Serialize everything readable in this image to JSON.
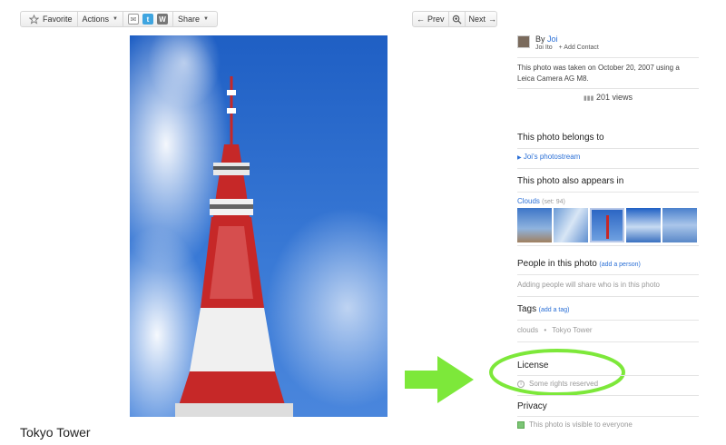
{
  "toolbar": {
    "favorite": "Favorite",
    "actions": "Actions",
    "share": "Share"
  },
  "pager": {
    "prev": "Prev",
    "next": "Next"
  },
  "photo": {
    "title": "Tokyo Tower"
  },
  "owner": {
    "by": "By",
    "name": "Joi",
    "fullname": "Joi Ito",
    "add_contact": "+ Add Contact",
    "taken": "This photo was taken on October 20, 2007 using a Leica Camera AG M8.",
    "views": "201 views"
  },
  "belongs": {
    "heading": "This photo belongs to",
    "link": "Joi's photostream"
  },
  "appears": {
    "heading": "This photo also appears in",
    "set": "Clouds",
    "set_count": "(set: 94)"
  },
  "people": {
    "heading": "People in this photo",
    "add": "(add a person)",
    "note": "Adding people will share who is in this photo"
  },
  "tags": {
    "heading": "Tags",
    "add": "(add a tag)",
    "items": [
      "clouds",
      "Tokyo Tower"
    ],
    "sep": "•"
  },
  "license": {
    "heading": "License",
    "text": "Some rights reserved"
  },
  "privacy": {
    "heading": "Privacy",
    "text": "This photo is visible to everyone"
  },
  "colors": {
    "accent": "#2a6fd6",
    "highlight": "#7de83a"
  }
}
